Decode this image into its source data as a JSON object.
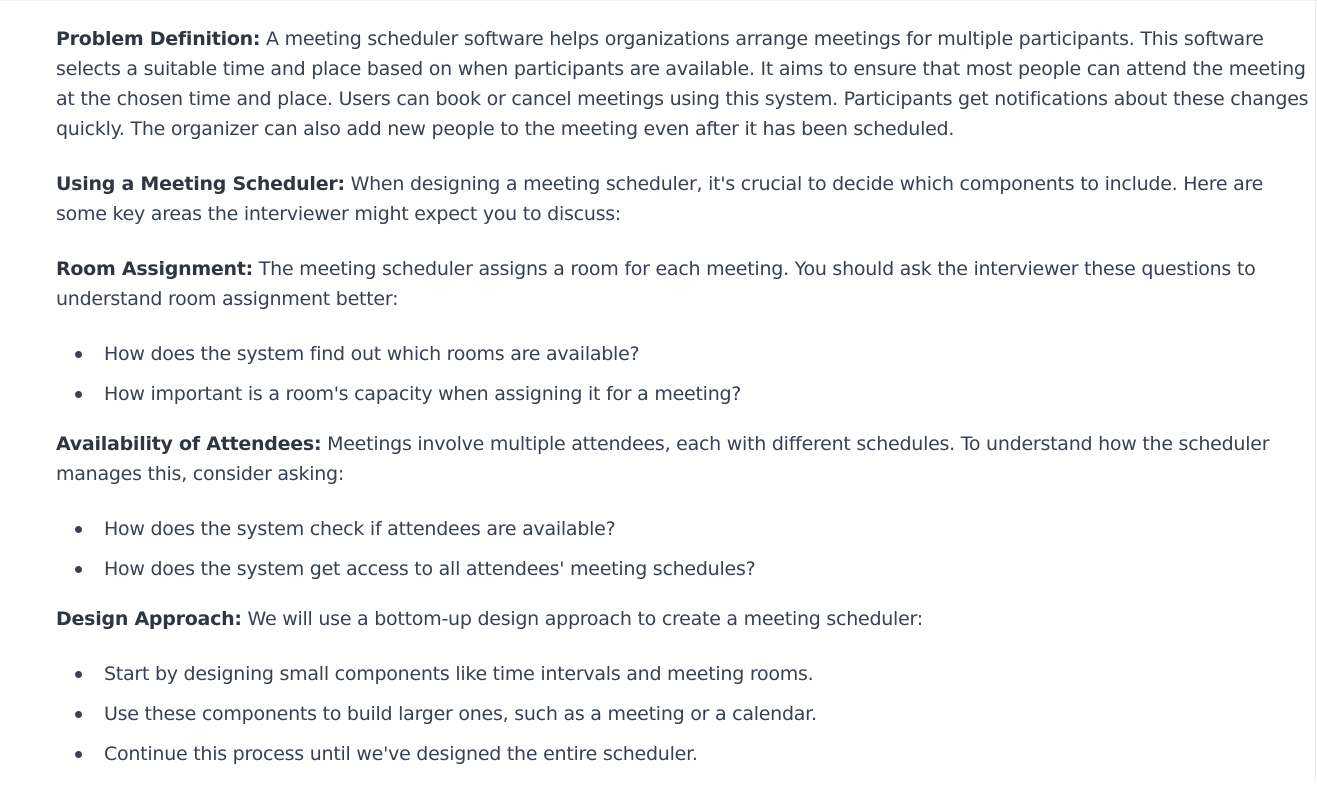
{
  "sections": [
    {
      "label": "Problem Definition:",
      "text": " A meeting scheduler software helps organizations arrange meetings for multiple participants. This software selects a suitable time and place based on when participants are available. It aims to ensure that most people can attend the meeting at the chosen time and place. Users can book or cancel meetings using this system. Participants get notifications about these changes quickly. The organizer can also add new people to the meeting even after it has been scheduled."
    },
    {
      "label": "Using a Meeting Scheduler:",
      "text": " When designing a meeting scheduler, it's crucial to decide which components to include. Here are some key areas the interviewer might expect you to discuss:"
    },
    {
      "label": "Room Assignment:",
      "text": " The meeting scheduler assigns a room for each meeting. You should ask the interviewer these questions to understand room assignment better:",
      "bullets": [
        "How does the system find out which rooms are available?",
        "How important is a room's capacity when assigning it for a meeting?"
      ]
    },
    {
      "label": "Availability of Attendees:",
      "text": " Meetings involve multiple attendees, each with different schedules. To understand how the scheduler manages this, consider asking:",
      "bullets": [
        "How does the system check if attendees are available?",
        "How does the system get access to all attendees' meeting schedules?"
      ]
    },
    {
      "label": "Design Approach:",
      "text": " We will use a bottom-up design approach to create a meeting scheduler:",
      "bullets": [
        "Start by designing small components like time intervals and meeting rooms.",
        "Use these components to build larger ones, such as a meeting or a calendar.",
        "Continue this process until we've designed the entire scheduler."
      ]
    }
  ]
}
